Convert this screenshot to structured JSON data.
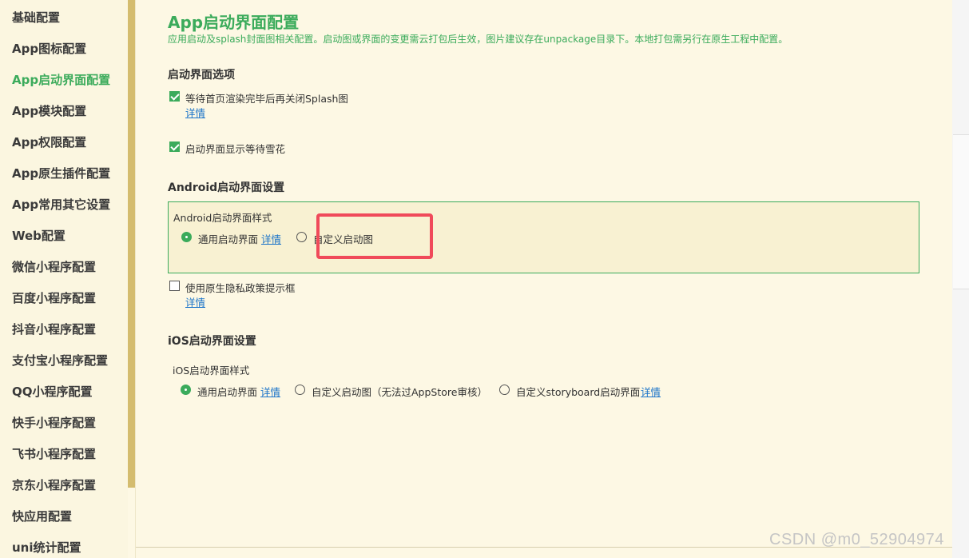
{
  "sidebar": {
    "items": [
      {
        "label": "基础配置",
        "active": false
      },
      {
        "label": "App图标配置",
        "active": false
      },
      {
        "label": "App启动界面配置",
        "active": true
      },
      {
        "label": "App模块配置",
        "active": false
      },
      {
        "label": "App权限配置",
        "active": false
      },
      {
        "label": "App原生插件配置",
        "active": false
      },
      {
        "label": "App常用其它设置",
        "active": false
      },
      {
        "label": "Web配置",
        "active": false
      },
      {
        "label": "微信小程序配置",
        "active": false
      },
      {
        "label": "百度小程序配置",
        "active": false
      },
      {
        "label": "抖音小程序配置",
        "active": false
      },
      {
        "label": "支付宝小程序配置",
        "active": false
      },
      {
        "label": "QQ小程序配置",
        "active": false
      },
      {
        "label": "快手小程序配置",
        "active": false
      },
      {
        "label": "飞书小程序配置",
        "active": false
      },
      {
        "label": "京东小程序配置",
        "active": false
      },
      {
        "label": "快应用配置",
        "active": false
      },
      {
        "label": "uni统计配置",
        "active": false
      }
    ]
  },
  "main": {
    "title": "App启动界面配置",
    "description": "应用启动及splash封面图相关配置。启动图或界面的变更需云打包后生效，图片建议存在unpackage目录下。本地打包需另行在原生工程中配置。",
    "splash_options": {
      "heading": "启动界面选项",
      "wait_first_page": {
        "label": "等待首页渲染完毕后再关闭Splash图",
        "checked": true,
        "link": "详情"
      },
      "show_snow": {
        "label": "启动界面显示等待雪花",
        "checked": true
      }
    },
    "android": {
      "heading": "Android启动界面设置",
      "style_label": "Android启动界面样式",
      "options": [
        {
          "label": "通用启动界面",
          "selected": true,
          "link": "详情"
        },
        {
          "label": "自定义启动图",
          "selected": false
        }
      ],
      "privacy": {
        "label": "使用原生隐私政策提示框",
        "checked": false,
        "link": "详情"
      }
    },
    "ios": {
      "heading": "iOS启动界面设置",
      "style_label": "iOS启动界面样式",
      "options": [
        {
          "label": "通用启动界面",
          "selected": true,
          "link": "详情"
        },
        {
          "label": "自定义启动图（无法过AppStore审核）",
          "selected": false
        },
        {
          "label": "自定义storyboard启动界面",
          "selected": false,
          "link": "详情"
        }
      ]
    }
  },
  "watermark": "CSDN @m0_52904974",
  "colors": {
    "accent": "#3bab5b",
    "highlight": "#f04a5a",
    "link": "#1a73c9",
    "background": "#fdf8e4"
  }
}
